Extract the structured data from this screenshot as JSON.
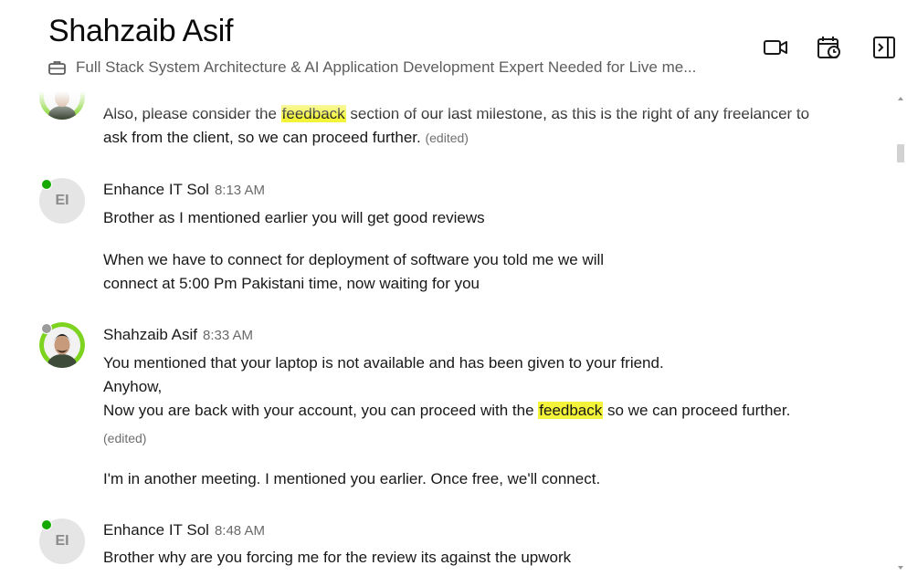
{
  "header": {
    "title": "Shahzaib Asif",
    "subtitle": "Full Stack System Architecture & AI Application Development Expert Needed for Live me...",
    "icons": [
      "video-icon",
      "schedule-icon",
      "panel-toggle-icon"
    ]
  },
  "messages": [
    {
      "lines": [
        {
          "pre": "Also, please consider the ",
          "hl": "feedback",
          "post": " section of our last milestone, as this is the right of any freelancer to"
        },
        {
          "text": "ask from the client, so we can proceed further.",
          "edited": "(edited)"
        }
      ]
    },
    {
      "author": "Enhance IT Sol",
      "initials": "EI",
      "time": "8:13 AM",
      "status": "online",
      "lines": [
        "Brother as I mentioned earlier you will get good reviews",
        "When we have to connect for deployment of software you told me we will",
        "connect at 5:00 Pm Pakistani time, now waiting for you"
      ]
    },
    {
      "author": "Shahzaib Asif",
      "time": "8:33 AM",
      "status": "offline",
      "lines": [
        "You mentioned that your laptop is not available and has been given to your friend.",
        "Anyhow,",
        {
          "pre": "Now you are back with your account, you can proceed with the ",
          "hl": "feedback",
          "post": " so we can proceed further."
        },
        {
          "edited": "(edited)"
        },
        "I'm in another meeting. I mentioned you earlier. Once free, we'll connect."
      ]
    },
    {
      "author": "Enhance IT Sol",
      "initials": "EI",
      "time": "8:48 AM",
      "status": "online",
      "lines": [
        "Brother why are you forcing me for the review its against the upwork"
      ]
    }
  ],
  "colors": {
    "online": "#14a800",
    "highlight": "#f3f33a",
    "avatar_accent": "#7ed321"
  }
}
